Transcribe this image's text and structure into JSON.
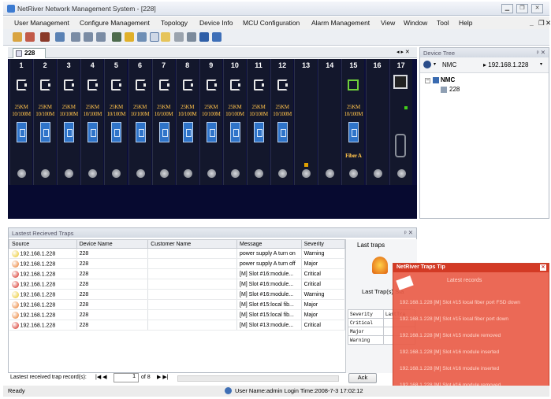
{
  "window": {
    "title": "NetRiver Network Management System - [228]"
  },
  "menu": [
    "User Management",
    "Configure Management",
    "Topology",
    "Device Info",
    "MCU Configuration",
    "Alarm Management",
    "View",
    "Window",
    "Tool",
    "Help"
  ],
  "tab": {
    "label": "228"
  },
  "chassis": {
    "slots": [
      {
        "num": "1",
        "type": "card",
        "label1": "25KM",
        "label2": "10/100M"
      },
      {
        "num": "2",
        "type": "card",
        "label1": "25KM",
        "label2": "10/100M"
      },
      {
        "num": "3",
        "type": "card",
        "label1": "25KM",
        "label2": "10/100M"
      },
      {
        "num": "4",
        "type": "card",
        "label1": "25KM",
        "label2": "10/100M"
      },
      {
        "num": "5",
        "type": "card",
        "label1": "25KM",
        "label2": "10/100M"
      },
      {
        "num": "6",
        "type": "card",
        "label1": "25KM",
        "label2": "10/100M"
      },
      {
        "num": "7",
        "type": "card",
        "label1": "25KM",
        "label2": "10/100M"
      },
      {
        "num": "8",
        "type": "card",
        "label1": "25KM",
        "label2": "10/100M"
      },
      {
        "num": "9",
        "type": "card",
        "label1": "25KM",
        "label2": "10/100M"
      },
      {
        "num": "10",
        "type": "card",
        "label1": "25KM",
        "label2": "10/100M"
      },
      {
        "num": "11",
        "type": "card",
        "label1": "25KM",
        "label2": "10/100M"
      },
      {
        "num": "12",
        "type": "card",
        "label1": "25KM",
        "label2": "10/100M"
      },
      {
        "num": "13",
        "type": "empty-alarm"
      },
      {
        "num": "14",
        "type": "empty"
      },
      {
        "num": "15",
        "type": "fiber",
        "label1": "25KM",
        "label2": "10/100M",
        "label3": "Fiber A"
      },
      {
        "num": "16",
        "type": "empty"
      },
      {
        "num": "17",
        "type": "mcu"
      }
    ]
  },
  "device_tree": {
    "title": "Device Tree",
    "filter": "NMC",
    "address": "192.168.1.228",
    "root": "NMC",
    "child": "228"
  },
  "traps": {
    "title": "Lastest Recieved Traps",
    "columns": [
      "Source",
      "Device Name",
      "Customer Name",
      "Message",
      "Severity"
    ],
    "rows": [
      {
        "source": "192.168.1.228",
        "device": "228",
        "customer": "",
        "message": "power supply A turn on",
        "severity": "Warning",
        "color": "#e9c419"
      },
      {
        "source": "192.168.1.228",
        "device": "228",
        "customer": "",
        "message": "power supply A turn off",
        "severity": "Major",
        "color": "#e8731f"
      },
      {
        "source": "192.168.1.228",
        "device": "228",
        "customer": "",
        "message": "[M] Slot #16:module...",
        "severity": "Critical",
        "color": "#d21b10"
      },
      {
        "source": "192.168.1.228",
        "device": "228",
        "customer": "",
        "message": "[M] Slot #16:module...",
        "severity": "Critical",
        "color": "#d21b10"
      },
      {
        "source": "192.168.1.228",
        "device": "228",
        "customer": "",
        "message": "[M] Slot #16:module...",
        "severity": "Warning",
        "color": "#e9c419"
      },
      {
        "source": "192.168.1.228",
        "device": "228",
        "customer": "",
        "message": "[M] Slot #15:local fib...",
        "severity": "Major",
        "color": "#e8731f"
      },
      {
        "source": "192.168.1.228",
        "device": "228",
        "customer": "",
        "message": "[M] Slot #15:local fib...",
        "severity": "Major",
        "color": "#e8731f"
      },
      {
        "source": "192.168.1.228",
        "device": "228",
        "customer": "",
        "message": "[M] Slot #13:module...",
        "severity": "Critical",
        "color": "#d21b10"
      }
    ],
    "pager_label": "Lastest received trap record(s):",
    "page_current": "1",
    "page_total": "of 8"
  },
  "last_traps": {
    "title": "Last traps",
    "stat_label": "Last Trap(s) Sta",
    "sev_header": [
      "Severity",
      "LastTra"
    ],
    "sev_rows": [
      "Critical",
      "Major",
      "Warning"
    ],
    "ack_label": "Ack"
  },
  "popup": {
    "title": "NetRiver Traps Tip",
    "subtitle": "Latest records",
    "messages": [
      "192.168.1.228 [M] Slot #15 local fiber port FSD down",
      "192.168.1.228 [M] Slot #15 local fiber port down",
      "192.168.1.228 [M] Slot #15 module removed",
      "192.168.1.228 [M] Slot #16 module inserted",
      "192.168.1.228 [M] Slot #16 module inserted",
      "192.168.1.228 [M] Slot #16 module removed"
    ]
  },
  "status": {
    "left": "Ready",
    "user_info": "User Name:admin Login Time:2008-7-3 17:02:12"
  }
}
